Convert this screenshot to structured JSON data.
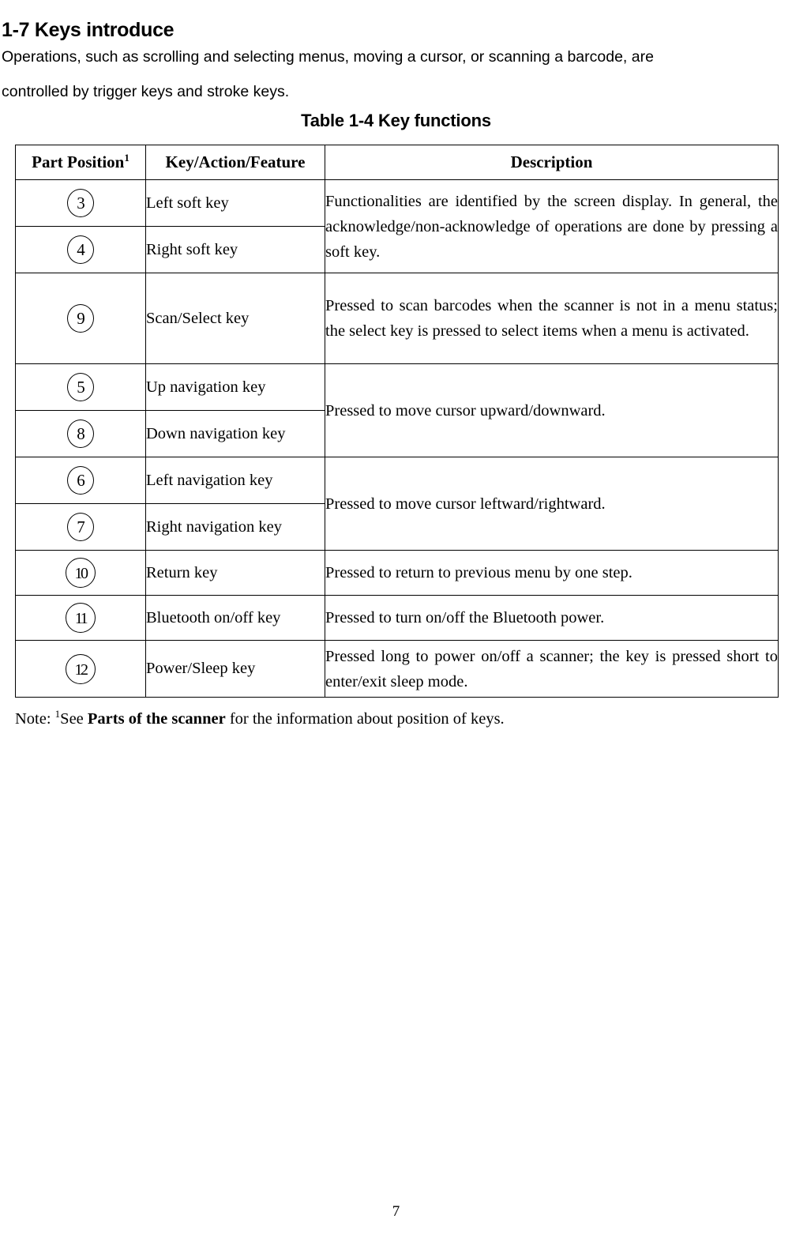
{
  "document": {
    "section_heading": "1-7 Keys introduce",
    "intro_paragraph_line1": "Operations, such as scrolling and selecting menus, moving a cursor, or scanning a barcode, are",
    "intro_paragraph_line2": "controlled by trigger keys and stroke keys.",
    "table_caption": "Table 1-4 Key functions",
    "page_number": "7"
  },
  "table": {
    "headers": {
      "part_position": "Part Position",
      "part_position_superscript": "1",
      "key_action_feature": "Key/Action/Feature",
      "description": "Description"
    },
    "rows": [
      {
        "position": "3",
        "key": "Left soft key",
        "description": ""
      },
      {
        "position": "4",
        "key": "Right soft key",
        "description": "Functionalities are identified by the screen display. In general, the acknowledge/non-acknowledge of operations are done by pressing a soft key."
      },
      {
        "position": "9",
        "key": "Scan/Select key",
        "description": "Pressed to scan barcodes when the scanner is not in a menu status; the select key is pressed to select items when a menu is activated."
      },
      {
        "position": "5",
        "key": "Up navigation key",
        "description": ""
      },
      {
        "position": "8",
        "key": "Down navigation key",
        "description": "Pressed to move cursor upward/downward."
      },
      {
        "position": "6",
        "key": "Left navigation key",
        "description": ""
      },
      {
        "position": "7",
        "key": "Right navigation key",
        "description": "Pressed to move cursor leftward/rightward."
      },
      {
        "position": "10",
        "key": "Return key",
        "description": "Pressed to return to previous menu by one step."
      },
      {
        "position": "11",
        "key": "Bluetooth on/off key",
        "description": "Pressed to turn on/off the Bluetooth power."
      },
      {
        "position": "12",
        "key": "Power/Sleep key",
        "description": "Pressed long to power on/off a scanner; the key is pressed short to enter/exit sleep mode."
      }
    ]
  },
  "note": {
    "prefix": "Note: ",
    "superscript": "1",
    "text_before_bold": "See ",
    "bold_text": "Parts of the scanner",
    "text_after_bold": " for the information about position of keys."
  }
}
